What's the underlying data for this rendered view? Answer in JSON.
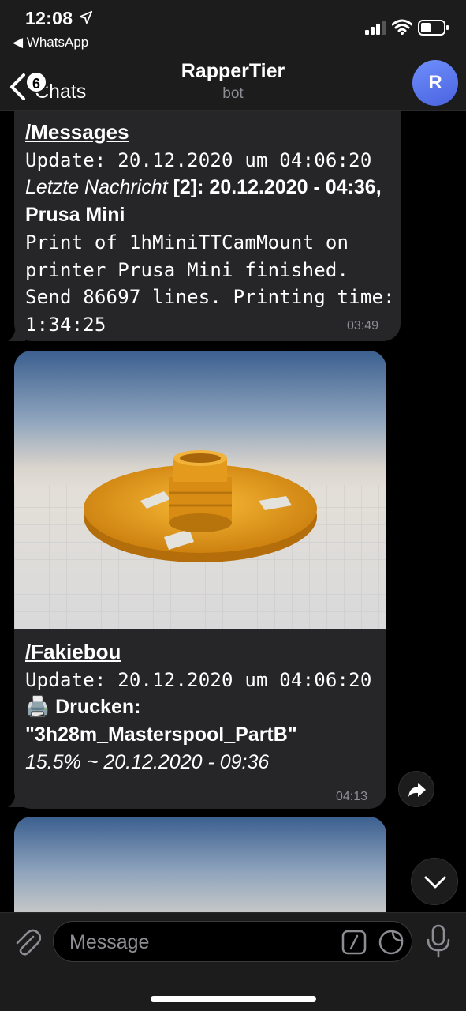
{
  "status_bar": {
    "time": "12:08",
    "back_app": "◀ WhatsApp"
  },
  "nav": {
    "back_badge": "6",
    "back_label": "Chats",
    "title": "RapperTier",
    "subtitle": "bot",
    "avatar_letter": "R"
  },
  "messages": [
    {
      "command": "/Messages",
      "update_line": "Update: 20.12.2020 um 04:06:20",
      "last_label": "Letzte Nachricht",
      "last_value": " [2]: 20.12.2020 - 04:36, Prusa Mini",
      "body": "Print of 1hMiniTTCamMount on printer Prusa Mini finished. Send 86697 lines. Printing time: 1:34:25",
      "time": "03:49"
    },
    {
      "command": "/Fakiebou",
      "update_line": "Update: 20.12.2020 um 04:06:20",
      "print_icon": "🖨️",
      "print_label": "Drucken:",
      "file_name": "\"3h28m_Masterspool_PartB\"",
      "progress_line": "15.5% ~ 20.12.2020 - 09:36",
      "time": "04:13"
    }
  ],
  "input": {
    "placeholder": "Message"
  },
  "colors": {
    "bubble": "#262628",
    "accent_avatar": "#5b78f0",
    "print_orange": "#f2a21a"
  }
}
